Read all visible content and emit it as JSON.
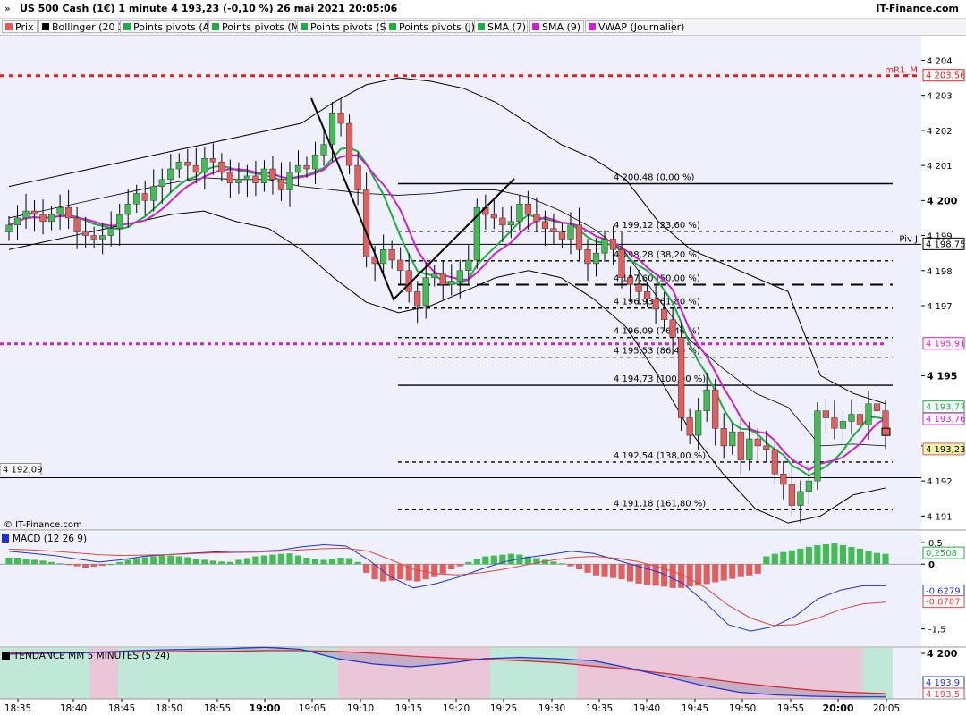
{
  "header": {
    "title": "US 500 Cash (1€) 1 minute 4 193,23 (-0,10 %) 26 mai 2021 20:05:06",
    "brand": "IT-Finance.com",
    "chevron": "»"
  },
  "legend": [
    {
      "label": "Prix",
      "color": "#e05a5a"
    },
    {
      "label": "Bollinger (20 2)",
      "color": "#000000"
    },
    {
      "label": "Points pivots (A)",
      "color": "#22aa44"
    },
    {
      "label": "Points pivots (M)",
      "color": "#22aa44"
    },
    {
      "label": "Points pivots (S)",
      "color": "#22aa44"
    },
    {
      "label": "Points pivots (J)",
      "color": "#22aa44"
    },
    {
      "label": "SMA (7)",
      "color": "#22aa44"
    },
    {
      "label": "SMA (9)",
      "color": "#cc22cc"
    },
    {
      "label": "VWAP (Journalier)",
      "color": "#cc22cc"
    }
  ],
  "chart_data": [
    {
      "panel": "price",
      "type": "candlestick",
      "ylim": [
        4190.6,
        4204.7
      ],
      "right_ticks": [
        4191,
        4192,
        4193,
        4195,
        4197,
        4198,
        4199,
        4200,
        4201,
        4202,
        4203,
        4204
      ],
      "right_tick_labels": [
        "4 191",
        "4 192",
        "4 193",
        "4 195",
        "4 197",
        "4 198",
        "4 199",
        "4 200",
        "4 201",
        "4 202",
        "4 203",
        "4 204"
      ],
      "bold_ticks": [
        4195,
        4200
      ],
      "x_labels": [
        "18:35",
        "18:40",
        "18:45",
        "18:50",
        "18:55",
        "19:00",
        "19:05",
        "19:10",
        "19:15",
        "19:20",
        "19:25",
        "19:30",
        "19:35",
        "19:40",
        "19:45",
        "19:50",
        "19:55",
        "20:00",
        "20:05"
      ],
      "bold_x_labels": [
        "19:00",
        "20:00"
      ],
      "close_series": [
        4199.3,
        4199.5,
        4199.7,
        4199.6,
        4199.4,
        4199.6,
        4199.8,
        4199.5,
        4199.1,
        4199.0,
        4198.9,
        4199.0,
        4199.2,
        4199.6,
        4199.9,
        4200.2,
        4200.0,
        4200.4,
        4200.6,
        4200.9,
        4201.1,
        4201.0,
        4200.8,
        4201.2,
        4201.1,
        4200.8,
        4200.5,
        4200.6,
        4200.7,
        4200.5,
        4200.9,
        4200.6,
        4200.3,
        4200.8,
        4201.0,
        4200.9,
        4201.3,
        4201.6,
        4202.5,
        4202.2,
        4201.0,
        4200.3,
        4198.4,
        4198.2,
        4198.6,
        4198.3,
        4198.0,
        4197.4,
        4197.0,
        4197.8,
        4197.9,
        4197.6,
        4197.7,
        4198.0,
        4198.3,
        4199.8,
        4199.6,
        4199.5,
        4199.3,
        4199.4,
        4199.9,
        4199.6,
        4199.4,
        4199.2,
        4199.1,
        4198.9,
        4199.3,
        4198.6,
        4198.2,
        4198.5,
        4198.9,
        4198.6,
        4197.8,
        4197.6,
        4197.4,
        4197.2,
        4196.9,
        4196.6,
        4196.1,
        4193.8,
        4193.3,
        4194.0,
        4194.6,
        4193.5,
        4193.0,
        4193.4,
        4192.6,
        4193.2,
        4193.0,
        4192.9,
        4192.2,
        4191.9,
        4191.3,
        4191.7,
        4192.0,
        4194.0,
        4193.8,
        4193.5,
        4193.7,
        4193.9,
        4193.6,
        4194.2,
        4194.0,
        4193.4
      ],
      "bollinger_upper": [
        4200.4,
        4200.6,
        4200.8,
        4201.0,
        4201.2,
        4201.4,
        4201.6,
        4201.8,
        4202.0,
        4202.2,
        4202.8,
        4203.3,
        4203.5,
        4203.4,
        4203.2,
        4202.8,
        4202.2,
        4201.6,
        4201.2,
        4200.6,
        4199.4,
        4198.6,
        4198.2,
        4197.8,
        4197.4,
        4195.0,
        4194.5,
        4194.2
      ],
      "bollinger_lower": [
        4198.6,
        4198.8,
        4199.0,
        4199.2,
        4199.4,
        4199.6,
        4199.7,
        4199.4,
        4199.2,
        4198.6,
        4197.8,
        4197.1,
        4196.8,
        4197.0,
        4197.4,
        4197.8,
        4198.0,
        4197.8,
        4197.2,
        4196.4,
        4195.0,
        4193.4,
        4192.2,
        4191.2,
        4190.8,
        4191.0,
        4191.6,
        4191.8
      ],
      "horizontal_levels": [
        {
          "label": "mR1_M",
          "value": 4203.56,
          "tag": "4 203,56",
          "style": "red-dotted"
        },
        {
          "label": "Piv J",
          "value": 4198.75,
          "tag": "4 198,75",
          "style": "solid"
        },
        {
          "label": "VWAP",
          "value": 4195.91,
          "tag": "4 195,91",
          "style": "magenta-dotted"
        },
        {
          "label": "",
          "value": 4192.09,
          "tag": "4 192,09",
          "style": "solid"
        }
      ],
      "fibonacci": [
        {
          "label": "4 200,48 (0,00 %)",
          "value": 4200.48,
          "style": "solid"
        },
        {
          "label": "4 199,12 (23,60 %)",
          "value": 4199.12,
          "style": "dashed"
        },
        {
          "label": "4 198,28 (38,20 %)",
          "value": 4198.28,
          "style": "dashed"
        },
        {
          "label": "4 197,60 (50,00 %)",
          "value": 4197.6,
          "style": "longdash"
        },
        {
          "label": "4 196,93 (61,80 %)",
          "value": 4196.93,
          "style": "dashed"
        },
        {
          "label": "4 196,09 (76,40 %)",
          "value": 4196.09,
          "style": "dashed"
        },
        {
          "label": "4 195,53 (86,40 %)",
          "value": 4195.53,
          "style": "dashed"
        },
        {
          "label": "4 194,73 (100,00 %)",
          "value": 4194.73,
          "style": "solid"
        },
        {
          "label": "4 192,54 (138,00 %)",
          "value": 4192.54,
          "style": "dashed"
        },
        {
          "label": "4 191,18 (161,80 %)",
          "value": 4191.18,
          "style": "dashed"
        }
      ],
      "value_tags": [
        {
          "text": "4 193,77",
          "value": 4193.77,
          "color": "#22aa44"
        },
        {
          "text": "4 193,76",
          "value": 4193.76,
          "color": "#cc22cc"
        },
        {
          "text": "4 193,23",
          "value": 4193.23,
          "color": "#e05a5a"
        }
      ],
      "watermark": "© IT-Finance.com"
    },
    {
      "panel": "macd",
      "type": "bar+line",
      "title": "MACD (12 26 9)",
      "ylim": [
        -1.9,
        0.75
      ],
      "ticks": [
        0.5,
        0,
        -1.5
      ],
      "tick_labels": [
        "0,5",
        "0",
        "-1,5"
      ],
      "histogram": [
        0.15,
        0.15,
        0.12,
        0.1,
        0.08,
        0.05,
        0.02,
        -0.02,
        -0.05,
        -0.08,
        -0.06,
        -0.04,
        0.0,
        0.05,
        0.1,
        0.14,
        0.16,
        0.18,
        0.2,
        0.2,
        0.18,
        0.16,
        0.12,
        0.1,
        0.08,
        0.06,
        0.05,
        0.1,
        0.14,
        0.18,
        0.2,
        0.22,
        0.24,
        0.25,
        0.2,
        0.15,
        0.12,
        0.1,
        0.12,
        0.15,
        0.14,
        0.05,
        -0.2,
        -0.35,
        -0.4,
        -0.38,
        -0.35,
        -0.38,
        -0.4,
        -0.35,
        -0.3,
        -0.22,
        -0.12,
        -0.05,
        0.05,
        0.12,
        0.18,
        0.2,
        0.22,
        0.24,
        0.22,
        0.18,
        0.14,
        0.1,
        0.06,
        0.02,
        -0.05,
        -0.12,
        -0.2,
        -0.26,
        -0.3,
        -0.32,
        -0.35,
        -0.4,
        -0.45,
        -0.48,
        -0.5,
        -0.52,
        -0.55,
        -0.55,
        -0.52,
        -0.5,
        -0.46,
        -0.42,
        -0.38,
        -0.34,
        -0.3,
        -0.26,
        -0.22,
        0.18,
        0.24,
        0.28,
        0.32,
        0.36,
        0.4,
        0.44,
        0.46,
        0.48,
        0.44,
        0.4,
        0.36,
        0.3,
        0.26,
        0.24
      ],
      "macd_line": [
        0.3,
        0.25,
        0.2,
        0.12,
        0.05,
        0.1,
        0.18,
        0.22,
        0.25,
        0.28,
        0.3,
        0.3,
        0.32,
        0.4,
        0.45,
        0.42,
        0.1,
        -0.3,
        -0.55,
        -0.45,
        -0.3,
        -0.12,
        0.05,
        0.15,
        0.22,
        0.3,
        0.25,
        0.1,
        -0.05,
        -0.2,
        -0.45,
        -0.9,
        -1.4,
        -1.55,
        -1.45,
        -1.2,
        -0.8,
        -0.6,
        -0.5,
        -0.5
      ],
      "signal_line": [
        0.35,
        0.33,
        0.3,
        0.26,
        0.22,
        0.2,
        0.21,
        0.22,
        0.24,
        0.26,
        0.27,
        0.28,
        0.3,
        0.33,
        0.36,
        0.37,
        0.3,
        0.1,
        -0.12,
        -0.22,
        -0.25,
        -0.2,
        -0.12,
        -0.02,
        0.08,
        0.15,
        0.18,
        0.14,
        0.06,
        -0.08,
        -0.25,
        -0.55,
        -0.95,
        -1.25,
        -1.42,
        -1.4,
        -1.25,
        -1.05,
        -0.92,
        -0.88
      ],
      "value_tags": [
        {
          "text": "0,2508",
          "value": 0.2508,
          "color": "#22aa44"
        },
        {
          "text": "-0,6279",
          "value": -0.6279,
          "color": "#2233cc"
        },
        {
          "text": "-0,8787",
          "value": -0.8787,
          "color": "#dd4444"
        }
      ]
    },
    {
      "panel": "tendance",
      "type": "line",
      "title": "TENDANCE MM 5 MINUTES (5 24)",
      "ylim": [
        4193.2,
        4200.8
      ],
      "ticks": [
        4200
      ],
      "tick_labels": [
        "4 200"
      ],
      "mm5": [
        4199.9,
        4200.0,
        4200.1,
        4200.3,
        4200.5,
        4200.6,
        4200.7,
        4200.9,
        4200.6,
        4199.2,
        4198.4,
        4198.0,
        4198.5,
        4199.2,
        4199.4,
        4199.2,
        4198.9,
        4197.8,
        4196.5,
        4195.2,
        4194.2,
        4193.8,
        4193.6,
        4193.5,
        4193.5
      ],
      "mm24": [
        4200.1,
        4200.1,
        4200.1,
        4200.2,
        4200.2,
        4200.3,
        4200.3,
        4200.4,
        4200.4,
        4200.3,
        4200.0,
        4199.6,
        4199.3,
        4199.1,
        4198.9,
        4198.6,
        4198.1,
        4197.6,
        4197.0,
        4196.3,
        4195.6,
        4195.0,
        4194.5,
        4194.2,
        4194.0
      ],
      "value_tags": [
        {
          "text": "4 193,9",
          "value": 4193.9,
          "color": "#2233cc"
        },
        {
          "text": "4 193,5",
          "value": 4193.5,
          "color": "#dd4444"
        }
      ],
      "background_bands": [
        "green",
        "pink",
        "green",
        "pink",
        "green",
        "pink",
        "green"
      ]
    }
  ]
}
